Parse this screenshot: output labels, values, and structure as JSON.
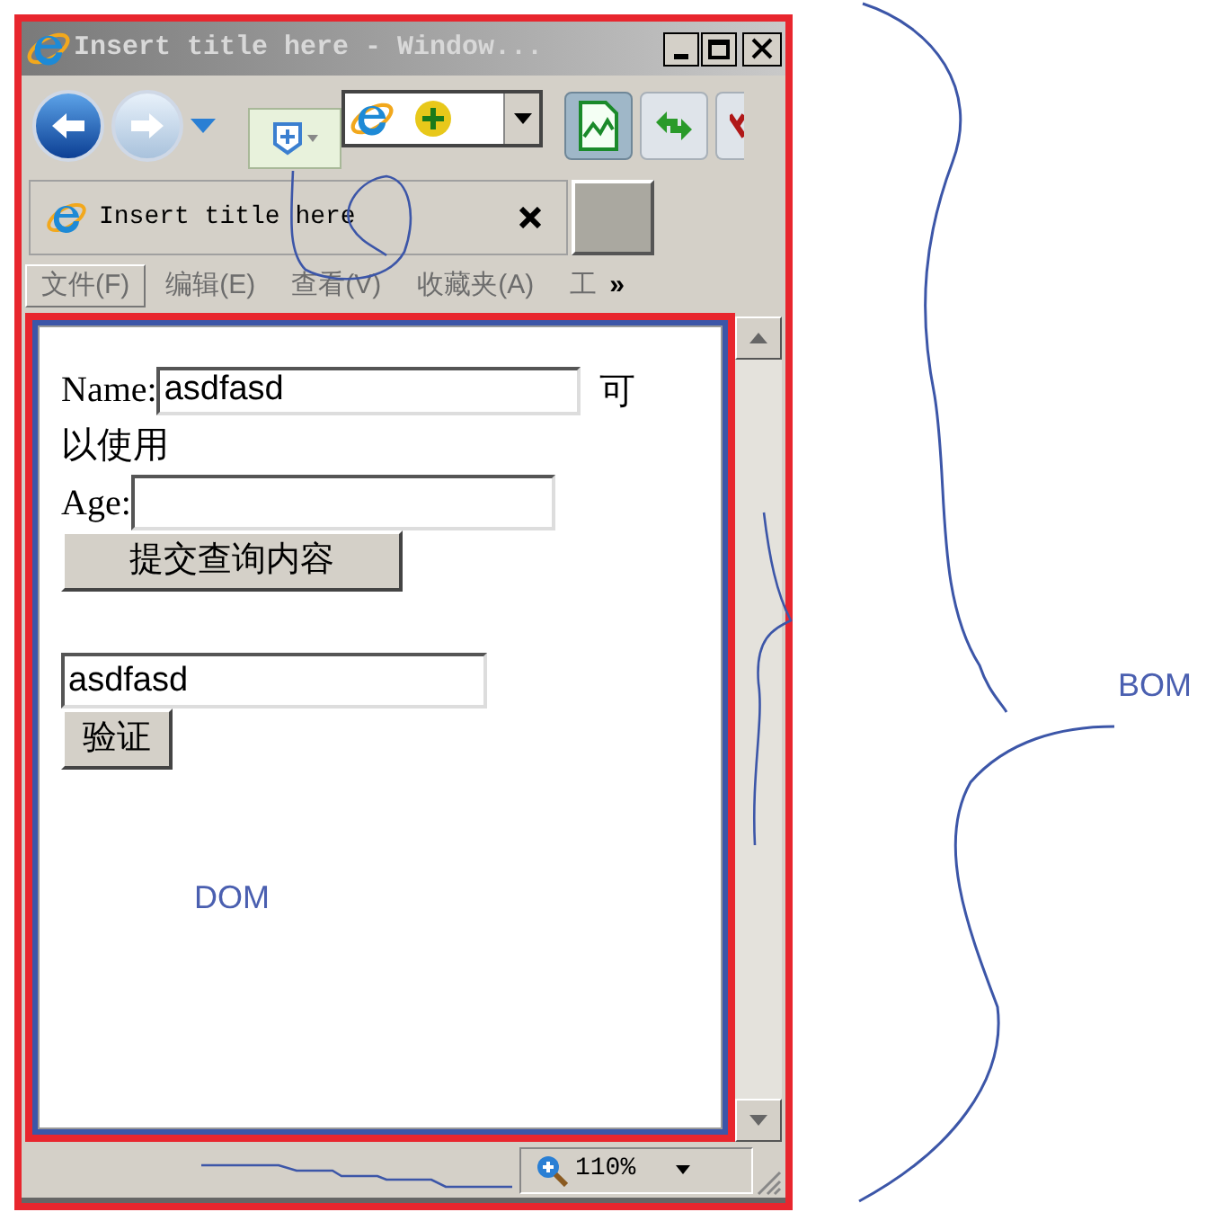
{
  "window": {
    "title": "Insert title here - Window..."
  },
  "tab": {
    "title": "Insert title here"
  },
  "menu": [
    {
      "label": "文件(F)",
      "selected": true
    },
    {
      "label": "编辑(E)",
      "selected": false
    },
    {
      "label": "查看(V)",
      "selected": false
    },
    {
      "label": "收藏夹(A)",
      "selected": false
    },
    {
      "label": "工",
      "selected": false
    }
  ],
  "menu_overflow": "»",
  "form": {
    "name_label": "Name:",
    "name_value": "asdfasd",
    "name_status_lines": [
      "可",
      "以使用"
    ],
    "age_label": "Age:",
    "submit": "提交查询内容",
    "check_value": "asdfasd",
    "verify": "验证"
  },
  "annotations": {
    "dom_label": "DOM",
    "bom_label": "BOM"
  },
  "status_bar": {
    "zoom": "110%"
  }
}
